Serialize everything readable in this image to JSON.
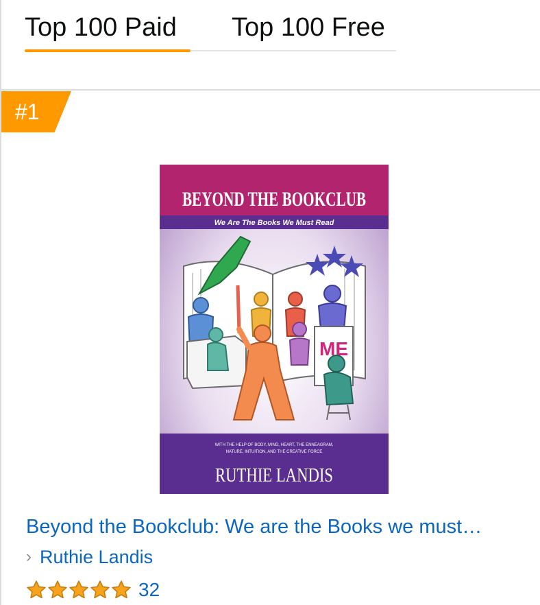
{
  "tabs": {
    "paid_label": "Top 100 Paid",
    "free_label": "Top 100 Free",
    "active": "paid"
  },
  "listing": {
    "rank": "#1",
    "cover": {
      "title": "BEYOND THE BOOKCLUB",
      "subtitle": "We Are The Books We Must Read",
      "tagline_line1": "WITH THE HELP OF BODY, MIND, HEART, THE ENNEAGRAM,",
      "tagline_line2": "NATURE, INTUITION, AND THE CREATIVE FORCE",
      "author": "RUTHIE LANDIS",
      "sign_text": "ME"
    },
    "title": "Beyond the Bookclub: We are the Books we must…",
    "author": "Ruthie Landis",
    "rating": 5,
    "rating_max": 5,
    "review_count": "32"
  },
  "colors": {
    "accent": "#ff9900",
    "link": "#0b66c2",
    "cover_magenta": "#b3246e",
    "cover_purple": "#5a2d91",
    "star": "#f7a31b"
  }
}
